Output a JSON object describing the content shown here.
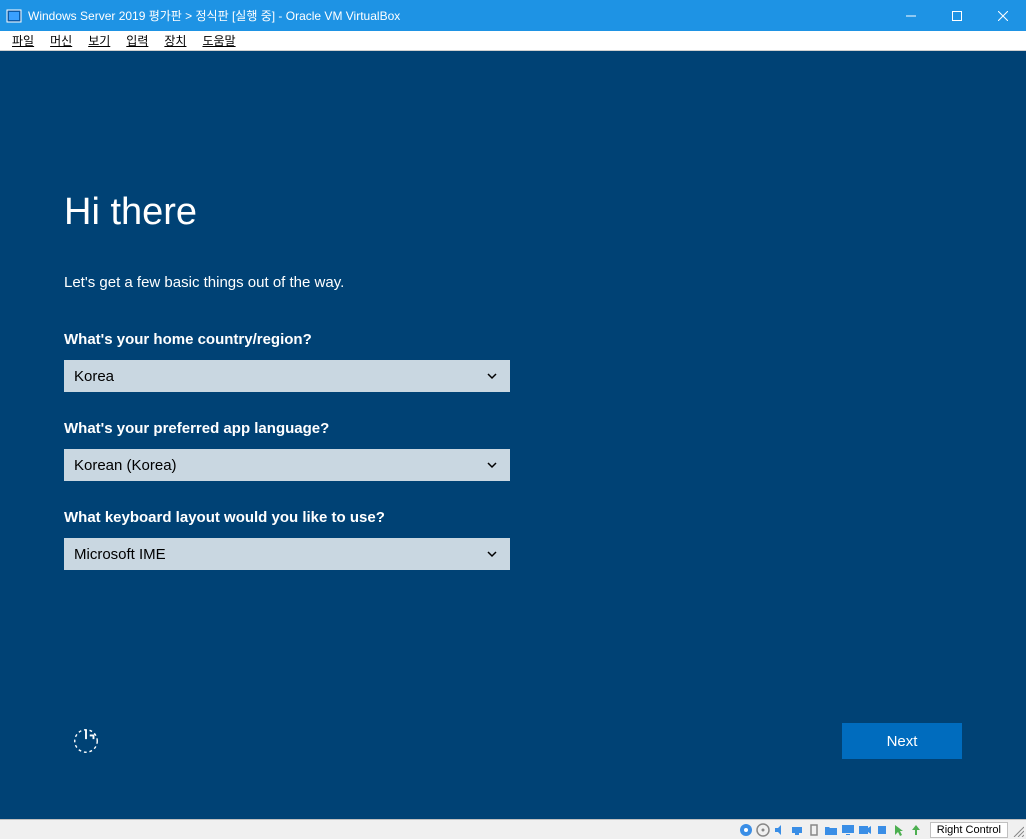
{
  "window": {
    "title": "Windows Server 2019 평가판 > 정식판 [실행 중] - Oracle VM VirtualBox"
  },
  "menu": {
    "items": [
      "파일",
      "머신",
      "보기",
      "입력",
      "장치",
      "도움말"
    ]
  },
  "oobe": {
    "heading": "Hi there",
    "subtitle": "Let's get a few basic things out of the way.",
    "country_label": "What's your home country/region?",
    "country_value": "Korea",
    "language_label": "What's your preferred app language?",
    "language_value": "Korean (Korea)",
    "keyboard_label": "What keyboard layout would you like to use?",
    "keyboard_value": "Microsoft IME",
    "next_label": "Next"
  },
  "statusbar": {
    "host_key": "Right Control"
  }
}
